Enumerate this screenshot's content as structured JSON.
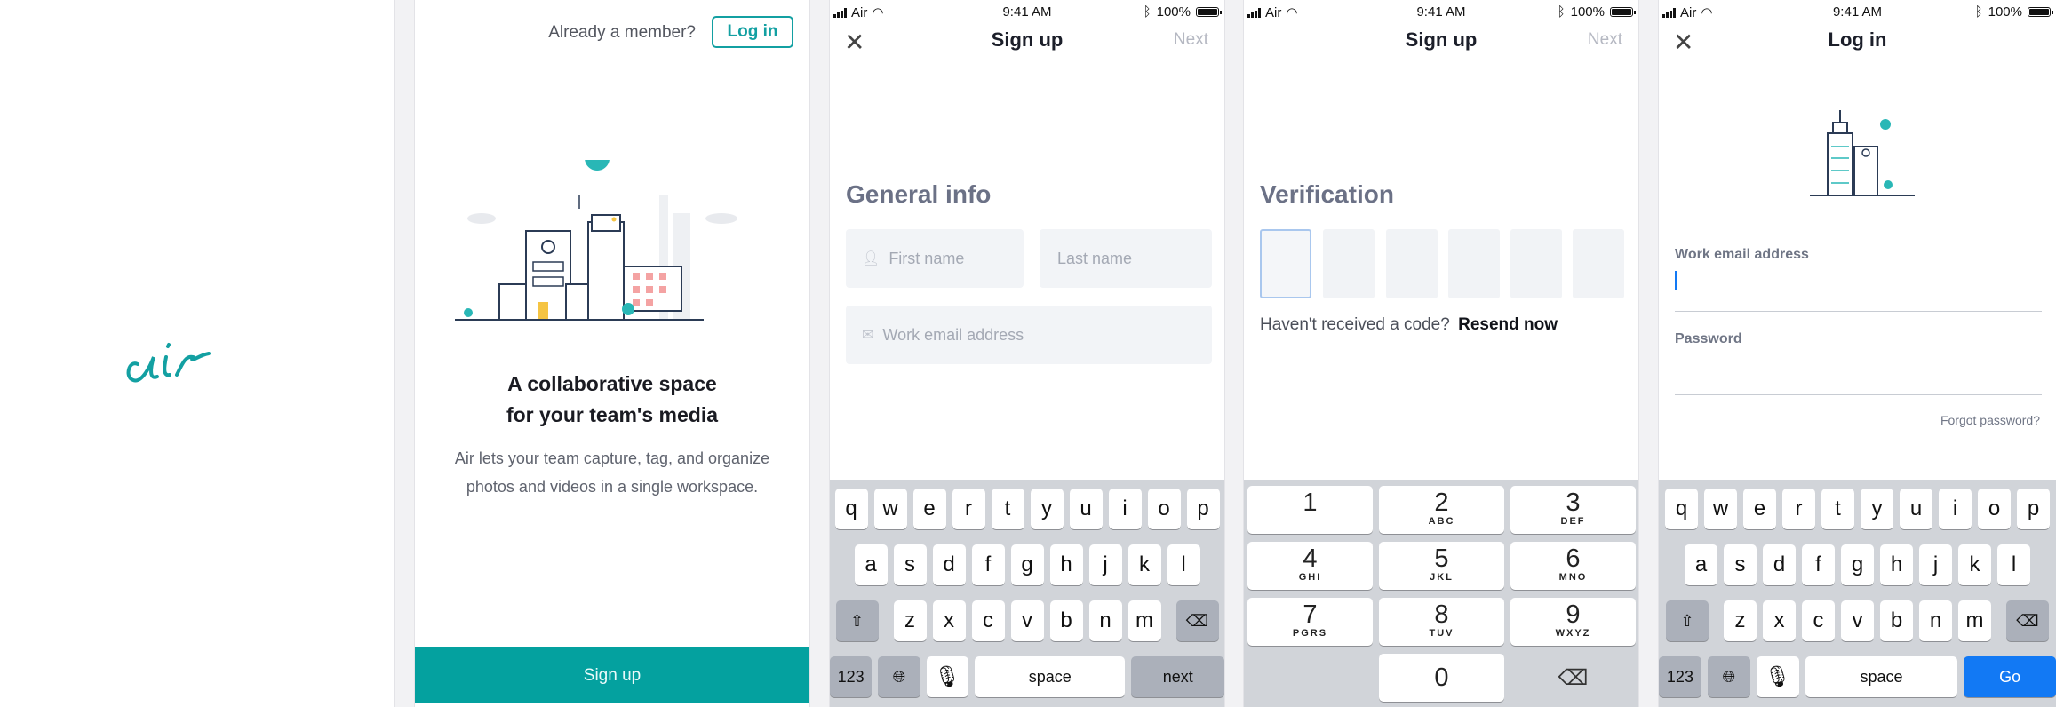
{
  "status": {
    "carrier": "Air",
    "time": "9:41 AM",
    "battery": "100%"
  },
  "splash": {
    "logo_text": "air",
    "brand_color": "#13a0a2"
  },
  "welcome": {
    "already_member": "Already a member?",
    "login_label": "Log in",
    "headline_line1": "A collaborative space",
    "headline_line2": "for your team's media",
    "desc_line1": "Air lets your team capture, tag, and organize",
    "desc_line2": "photos and videos in a single workspace.",
    "signup_label": "Sign up"
  },
  "signup_general": {
    "title": "Sign up",
    "next_label": "Next",
    "section_title": "General info",
    "first_name_placeholder": "First name",
    "last_name_placeholder": "Last name",
    "email_placeholder": "Work email address"
  },
  "signup_verify": {
    "title": "Sign up",
    "next_label": "Next",
    "section_title": "Verification",
    "no_code_text": "Haven't received a code?",
    "resend_label": "Resend now"
  },
  "login": {
    "title": "Log in",
    "email_label": "Work email address",
    "password_label": "Password",
    "forgot_label": "Forgot password?"
  },
  "keyboard": {
    "row1": [
      "q",
      "w",
      "e",
      "r",
      "t",
      "y",
      "u",
      "i",
      "o",
      "p"
    ],
    "row2": [
      "a",
      "s",
      "d",
      "f",
      "g",
      "h",
      "j",
      "k",
      "l"
    ],
    "row3": [
      "z",
      "x",
      "c",
      "v",
      "b",
      "n",
      "m"
    ],
    "numbers_label": "123",
    "space_label": "space",
    "next_label": "next",
    "go_label": "Go",
    "numpad": [
      {
        "n": "1",
        "s": ""
      },
      {
        "n": "2",
        "s": "ABC"
      },
      {
        "n": "3",
        "s": "DEF"
      },
      {
        "n": "4",
        "s": "GHI"
      },
      {
        "n": "5",
        "s": "JKL"
      },
      {
        "n": "6",
        "s": "MNO"
      },
      {
        "n": "7",
        "s": "PGRS"
      },
      {
        "n": "8",
        "s": "TUV"
      },
      {
        "n": "9",
        "s": "WXYZ"
      },
      {
        "n": "0",
        "s": ""
      }
    ]
  }
}
